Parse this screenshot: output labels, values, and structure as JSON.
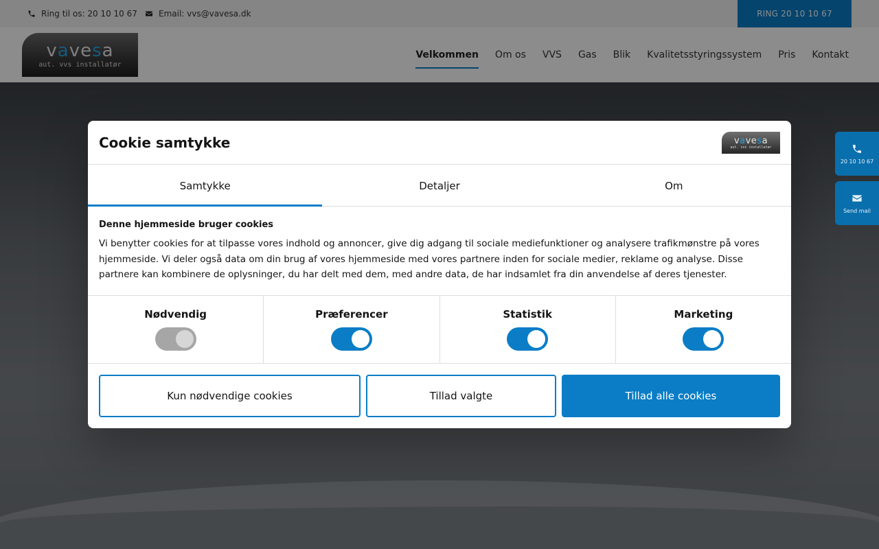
{
  "topbar": {
    "phone_label": "Ring til os: 20 10 10 67",
    "email_label": "Email: vvs@vavesa.dk",
    "cta": "RING 20 10 10 67"
  },
  "logo": {
    "brand_prefix": "v",
    "brand_accent": "a",
    "brand_middle": "ve",
    "brand_accent2": "s",
    "brand_suffix": "a",
    "tagline": "aut. vvs installatør"
  },
  "nav": {
    "items": [
      "Velkommen",
      "Om os",
      "VVS",
      "Gas",
      "Blik",
      "Kvalitetsstyringssystem",
      "Pris",
      "Kontakt"
    ],
    "active": "Velkommen"
  },
  "side": {
    "phone": "20 10 10 67",
    "mail": "Send mail"
  },
  "cookie": {
    "title": "Cookie samtykke",
    "tabs": [
      "Samtykke",
      "Detaljer",
      "Om"
    ],
    "active_tab": "Samtykke",
    "heading": "Denne hjemmeside bruger cookies",
    "text": "Vi benytter cookies for at tilpasse vores indhold og annoncer, give dig adgang til sociale mediefunktioner og analysere trafikmønstre på vores hjemmeside. Vi deler også data om din brug af vores hjemmeside med vores partnere inden for sociale medier, reklame og analyse. Disse partnere kan kombinere de oplysninger, du har delt med dem, med andre data, de har indsamlet fra din anvendelse af deres tjenester.",
    "categories": [
      {
        "label": "Nødvendig",
        "enabled": true,
        "locked": true
      },
      {
        "label": "Præferencer",
        "enabled": true,
        "locked": false
      },
      {
        "label": "Statistik",
        "enabled": true,
        "locked": false
      },
      {
        "label": "Marketing",
        "enabled": true,
        "locked": false
      }
    ],
    "buttons": {
      "necessary_only": "Kun nødvendige cookies",
      "allow_selected": "Tillad valgte",
      "allow_all": "Tillad alle cookies"
    }
  },
  "colors": {
    "accent": "#0a7dc6",
    "side_button": "#0a6fad",
    "toggle_disabled": "#a6a6a6"
  }
}
